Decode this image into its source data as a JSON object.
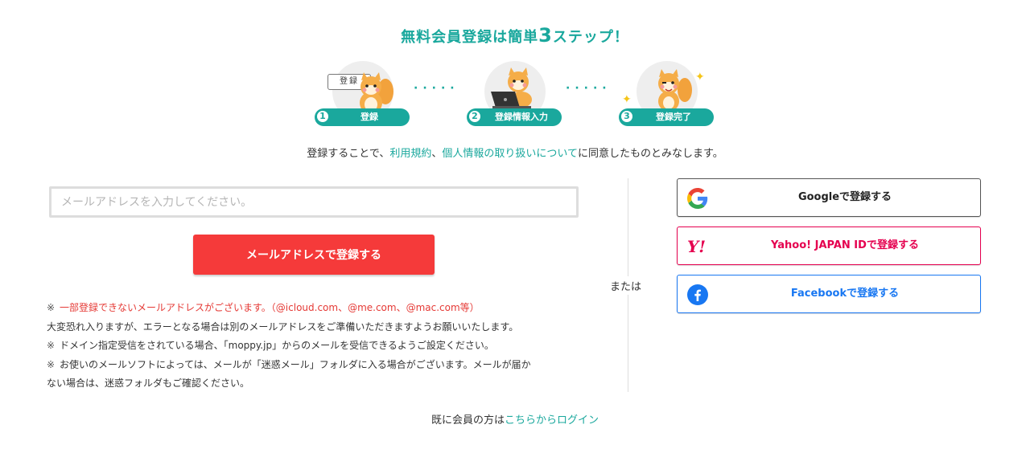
{
  "title": {
    "before": "無料会員登録は簡単",
    "number": "3",
    "after": "ステップ！"
  },
  "steps": [
    {
      "num": "1",
      "label": "登録",
      "speech": "登録"
    },
    {
      "num": "2",
      "label": "登録情報入力"
    },
    {
      "num": "3",
      "label": "登録完了"
    }
  ],
  "agreement": {
    "prefix": "登録することで、",
    "terms_link": "利用規約",
    "sep": "、",
    "privacy_link": "個人情報の取り扱いについて",
    "suffix": "に同意したものとみなします。"
  },
  "email_form": {
    "placeholder": "メールアドレスを入力してください。",
    "value": "",
    "submit_label": "メールアドレスで登録する"
  },
  "notes": {
    "mark": "※",
    "note1_red": "一部登録できないメールアドレスがございます。（@icloud.com、@me.com、@mac.com等）",
    "note1_sub": "大変恐れ入りますが、エラーとなる場合は別のメールアドレスをご準備いただきますようお願いいたします。",
    "note2": "ドメイン指定受信をされている場合、「moppy.jp」からのメールを受信できるようご設定ください。",
    "note3_line1": "お使いのメールソフトによっては、メールが「迷惑メール」フォルダに入る場合がございます。メールが届か",
    "note3_line2": "ない場合は、迷惑フォルダもご確認ください。"
  },
  "divider_label": "または",
  "social": {
    "google_label": "Googleで登録する",
    "yahoo_label": "Yahoo! JAPAN IDで登録する",
    "yahoo_logo": "Y!",
    "facebook_label": "Facebookで登録する"
  },
  "login": {
    "prefix": "既に会員の方は",
    "link": "こちらからログイン"
  },
  "colors": {
    "accent": "#1aa89d",
    "submit": "#f53a3a",
    "yahoo": "#e5004f",
    "facebook": "#1877f2",
    "note_red": "#e53935"
  }
}
